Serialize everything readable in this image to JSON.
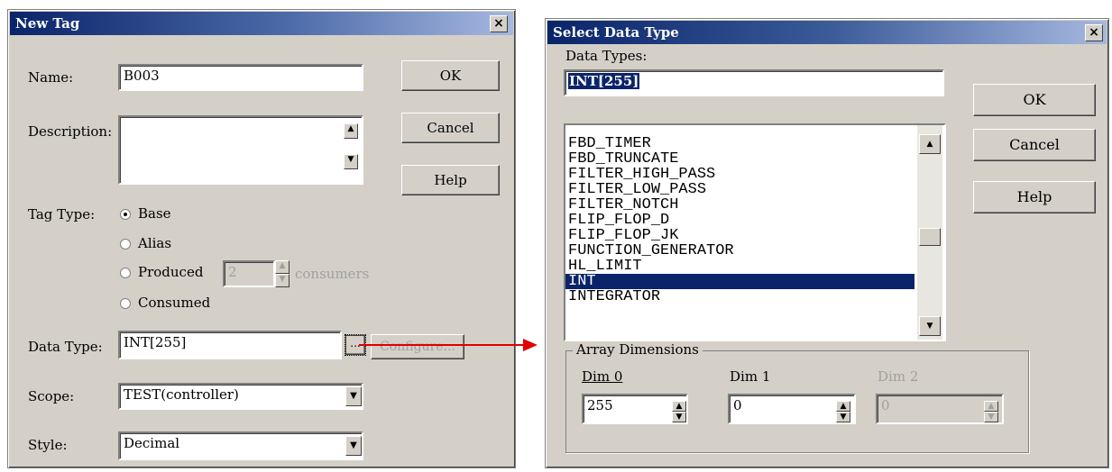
{
  "new_tag": {
    "title": "New Tag",
    "close_glyph": "×",
    "name_label": "Name:",
    "name_value": "B003",
    "description_label": "Description:",
    "description_value": "",
    "tag_type_label": "Tag Type:",
    "radio_base": "Base",
    "radio_alias": "Alias",
    "radio_produced": "Produced",
    "radio_consumed": "Consumed",
    "consumers_value": "2",
    "consumers_label": "consumers",
    "data_type_label": "Data Type:",
    "data_type_value": "INT[255]",
    "browse_label": "...",
    "configure_label": "Configure...",
    "scope_label": "Scope:",
    "scope_value": "TEST(controller)",
    "style_label": "Style:",
    "style_value": "Decimal",
    "ok": "OK",
    "cancel": "Cancel",
    "help": "Help"
  },
  "select_data_type": {
    "title": "Select Data Type",
    "close_glyph": "×",
    "data_types_label": "Data Types:",
    "data_types_value": "INT[255]",
    "list_items": [
      "FBD_TIMER",
      "FBD_TRUNCATE",
      "FILTER_HIGH_PASS",
      "FILTER_LOW_PASS",
      "FILTER_NOTCH",
      "FLIP_FLOP_D",
      "FLIP_FLOP_JK",
      "FUNCTION_GENERATOR",
      "HL_LIMIT",
      "INT",
      "INTEGRATOR"
    ],
    "selected_item": "INT",
    "array_dimensions_label": "Array Dimensions",
    "dim0_label": "Dim 0",
    "dim0_value": "255",
    "dim1_label": "Dim 1",
    "dim1_value": "0",
    "dim2_label": "Dim 2",
    "dim2_value": "0",
    "ok": "OK",
    "cancel": "Cancel",
    "help": "Help"
  },
  "colors": {
    "title_active": "#0a246a",
    "face": "#d4d0c8",
    "arrow": "#e00000"
  }
}
